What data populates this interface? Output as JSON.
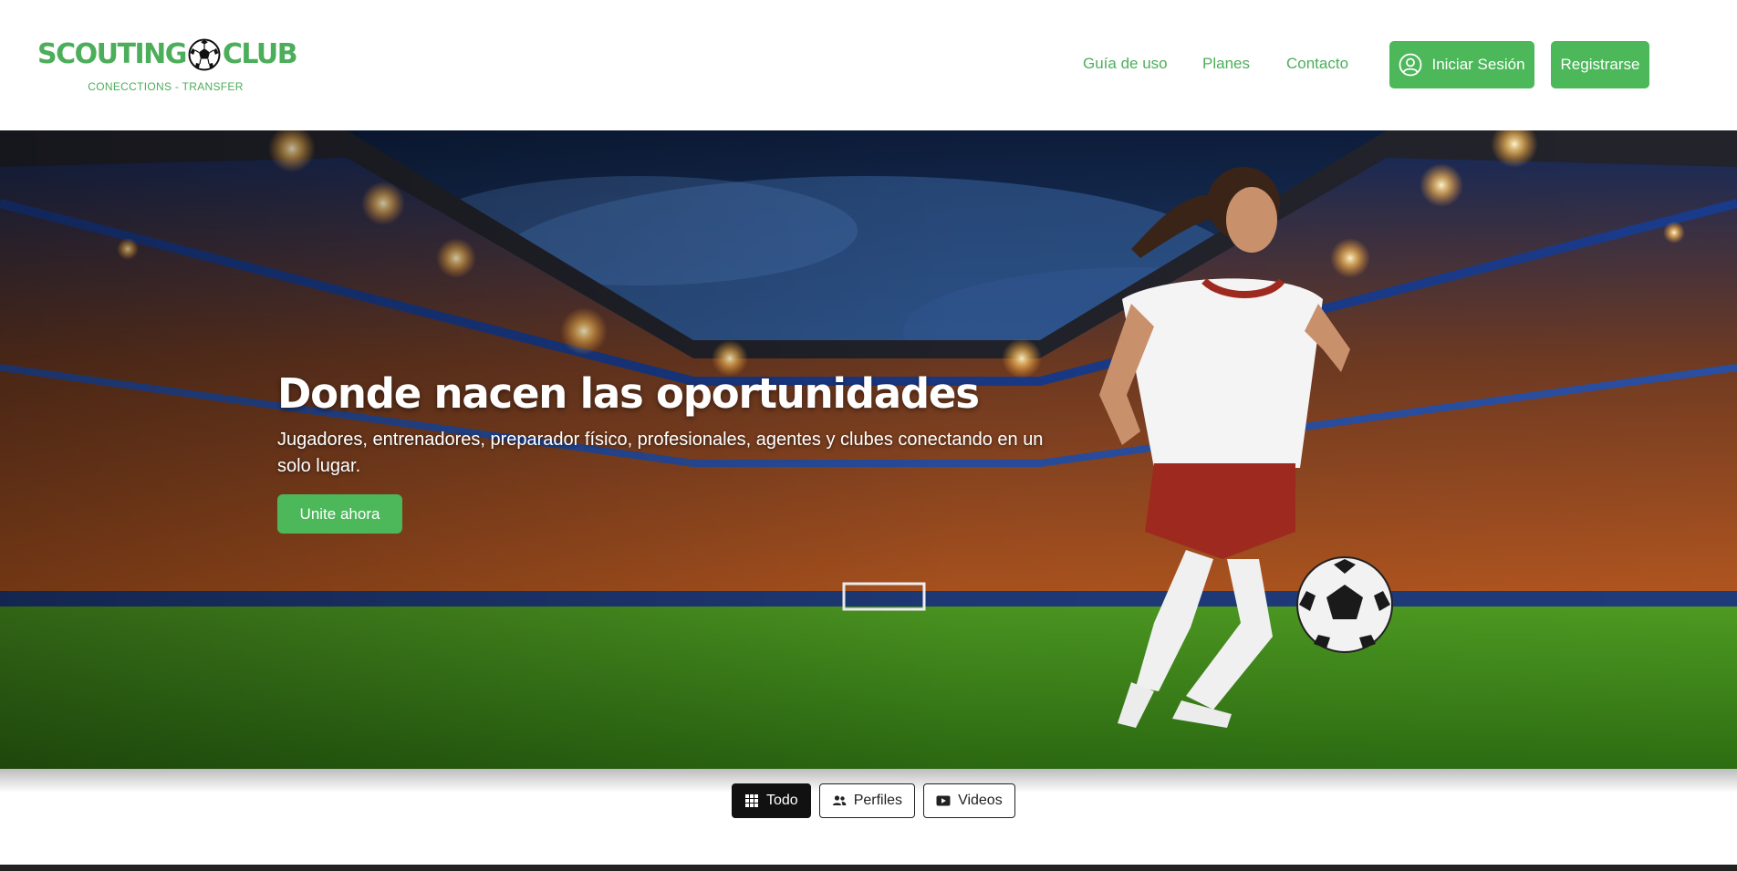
{
  "brand": {
    "name_left": "SCOUTING",
    "name_right": "CLUB",
    "tagline": "CONECCTIONS - TRANSFER",
    "color": "#4cae5a"
  },
  "nav": {
    "links": [
      "Guía de uso",
      "Planes",
      "Contacto"
    ],
    "login_label": "Iniciar Sesión",
    "register_label": "Registrarse",
    "button_color": "#4cb85a"
  },
  "hero": {
    "title": "Donde nacen las oportunidades",
    "subtitle": "Jugadores, entrenadores, preparador físico, profesionales, agentes y clubes conectando en un solo lugar.",
    "cta_label": "Unite ahora"
  },
  "filters": {
    "items": [
      {
        "label": "Todo",
        "icon": "grid-icon",
        "active": true
      },
      {
        "label": "Perfiles",
        "icon": "users-icon",
        "active": false
      },
      {
        "label": "Videos",
        "icon": "video-icon",
        "active": false
      }
    ]
  }
}
